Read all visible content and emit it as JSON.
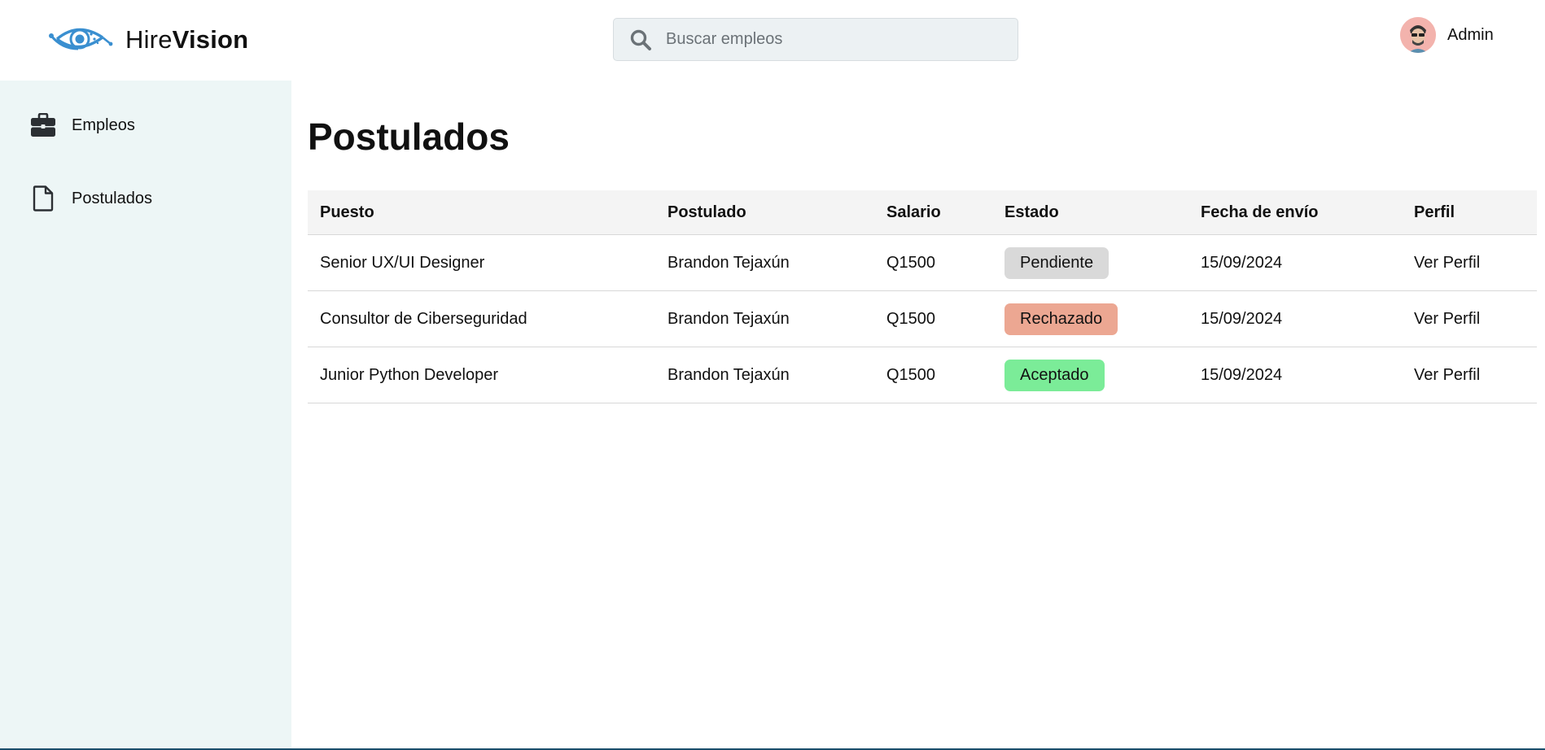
{
  "header": {
    "brand_light": "Hire",
    "brand_bold": "Vision",
    "logo_icon": "eye-logo-icon",
    "search": {
      "placeholder": "Buscar empleos",
      "value": ""
    },
    "user": {
      "name": "Admin",
      "avatar_icon": "avatar-icon"
    }
  },
  "sidebar": {
    "items": [
      {
        "label": "Empleos",
        "icon": "briefcase-icon"
      },
      {
        "label": "Postulados",
        "icon": "document-icon"
      }
    ]
  },
  "main": {
    "title": "Postulados",
    "table": {
      "columns": [
        "Puesto",
        "Postulado",
        "Salario",
        "Estado",
        "Fecha de envío",
        "Perfil"
      ],
      "rows": [
        {
          "puesto": "Senior UX/UI Designer",
          "postulado": "Brandon Tejaxún",
          "salario": "Q1500",
          "estado": "Pendiente",
          "estado_color": "#d9d9d9",
          "fecha": "15/09/2024",
          "perfil": "Ver Perfil"
        },
        {
          "puesto": "Consultor de Ciberseguridad",
          "postulado": "Brandon Tejaxún",
          "salario": "Q1500",
          "estado": "Rechazado",
          "estado_color": "#eca792",
          "fecha": "15/09/2024",
          "perfil": "Ver Perfil"
        },
        {
          "puesto": "Junior Python Developer",
          "postulado": "Brandon Tejaxún",
          "salario": "Q1500",
          "estado": "Aceptado",
          "estado_color": "#7bec98",
          "fecha": "15/09/2024",
          "perfil": "Ver Perfil"
        }
      ]
    }
  },
  "colors": {
    "sidebar_bg": "#edf6f6",
    "brand_blue": "#3a8fd0",
    "search_bg": "#ecf1f3"
  }
}
